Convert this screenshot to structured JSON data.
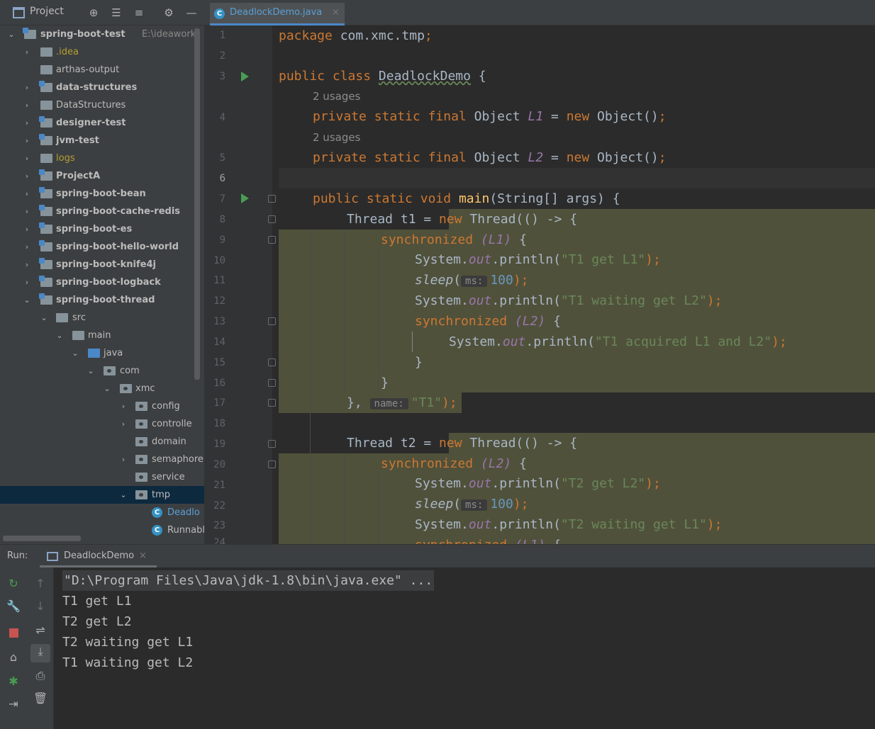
{
  "project_panel": {
    "title": "Project",
    "tree": [
      {
        "label": "spring-boot-test",
        "path": "E:\\ideawork",
        "kind": "module",
        "bold": true
      },
      {
        "label": ".idea",
        "kind": "folder-ignored"
      },
      {
        "label": "arthas-output",
        "kind": "folder"
      },
      {
        "label": "data-structures",
        "kind": "module",
        "bold": true
      },
      {
        "label": "DataStructures",
        "kind": "folder"
      },
      {
        "label": "designer-test",
        "kind": "module",
        "bold": true
      },
      {
        "label": "jvm-test",
        "kind": "module",
        "bold": true
      },
      {
        "label": "logs",
        "kind": "folder-ignored"
      },
      {
        "label": "ProjectA",
        "kind": "module",
        "bold": true
      },
      {
        "label": "spring-boot-bean",
        "kind": "module",
        "bold": true
      },
      {
        "label": "spring-boot-cache-redis",
        "kind": "module",
        "bold": true
      },
      {
        "label": "spring-boot-es",
        "kind": "module",
        "bold": true
      },
      {
        "label": "spring-boot-hello-world",
        "kind": "module",
        "bold": true
      },
      {
        "label": "spring-boot-knife4j",
        "kind": "module",
        "bold": true
      },
      {
        "label": "spring-boot-logback",
        "kind": "module",
        "bold": true
      },
      {
        "label": "spring-boot-thread",
        "kind": "module",
        "bold": true
      },
      {
        "label": "src",
        "kind": "folder"
      },
      {
        "label": "main",
        "kind": "folder"
      },
      {
        "label": "java",
        "kind": "source"
      },
      {
        "label": "com",
        "kind": "package"
      },
      {
        "label": "xmc",
        "kind": "package"
      },
      {
        "label": "config",
        "kind": "package"
      },
      {
        "label": "controlle",
        "kind": "package"
      },
      {
        "label": "domain",
        "kind": "package"
      },
      {
        "label": "semaphore",
        "kind": "package"
      },
      {
        "label": "service",
        "kind": "package"
      },
      {
        "label": "tmp",
        "kind": "package",
        "selected": true
      },
      {
        "label": "Deadlo",
        "kind": "class"
      },
      {
        "label": "Runnabl",
        "kind": "class"
      }
    ]
  },
  "editor": {
    "tab_label": "DeadlockDemo.java",
    "line_numbers": [
      "1",
      "2",
      "3",
      "4",
      "5",
      "6",
      "7",
      "8",
      "9",
      "10",
      "11",
      "12",
      "13",
      "14",
      "15",
      "16",
      "17",
      "18",
      "19",
      "20",
      "21",
      "22",
      "23",
      "24"
    ],
    "usages_hint": "2 usages",
    "code": {
      "l1_kw": "package",
      "l1_rest": " com.xmc.tmp",
      "semi": ";",
      "public": "public",
      "class": "class",
      "classname": "DeadlockDemo",
      "brace_open": " {",
      "private": "private",
      "static": "static",
      "final": "final",
      "object": "Object",
      "l1_field": "L1",
      "l2_field": "L2",
      "eq": " = ",
      "new": "new",
      "object_call": " Object()",
      "void": "void",
      "main": "main",
      "main_args": "(String[] args) {",
      "thread_t1": "Thread t1 = ",
      "thread_t2": "Thread t2 = ",
      "thread_lambda": " Thread(() -> {",
      "synchronized": "synchronized",
      "sync_l1": "(L1)",
      "sync_l2": "(L2)",
      "system": "System.",
      "out": "out",
      "println": ".println(",
      "s_t1_get_l1": "\"T1 get L1\"",
      "s_t1_wait_l2": "\"T1 waiting get L2\"",
      "s_t1_acq": "\"T1 acquired L1 and L2\"",
      "s_t2_get_l2": "\"T2 get L2\"",
      "s_t2_wait_l1": "\"T2 waiting get L1\"",
      "sleep": "sleep",
      "ms_hint": "ms:",
      "ms_val": "100",
      "close_call": ");",
      "close_brace": "}",
      "close_lambda": "},",
      "name_hint": "name:",
      "s_t1": "\"T1\"",
      "s_l17_tail": ");"
    }
  },
  "run_panel": {
    "label": "Run:",
    "tab_label": "DeadlockDemo",
    "console": [
      "\"D:\\Program Files\\Java\\jdk-1.8\\bin\\java.exe\" ...",
      "T1 get L1",
      "T2 get L2",
      "T2 waiting get L1",
      "T1 waiting get L2"
    ]
  }
}
